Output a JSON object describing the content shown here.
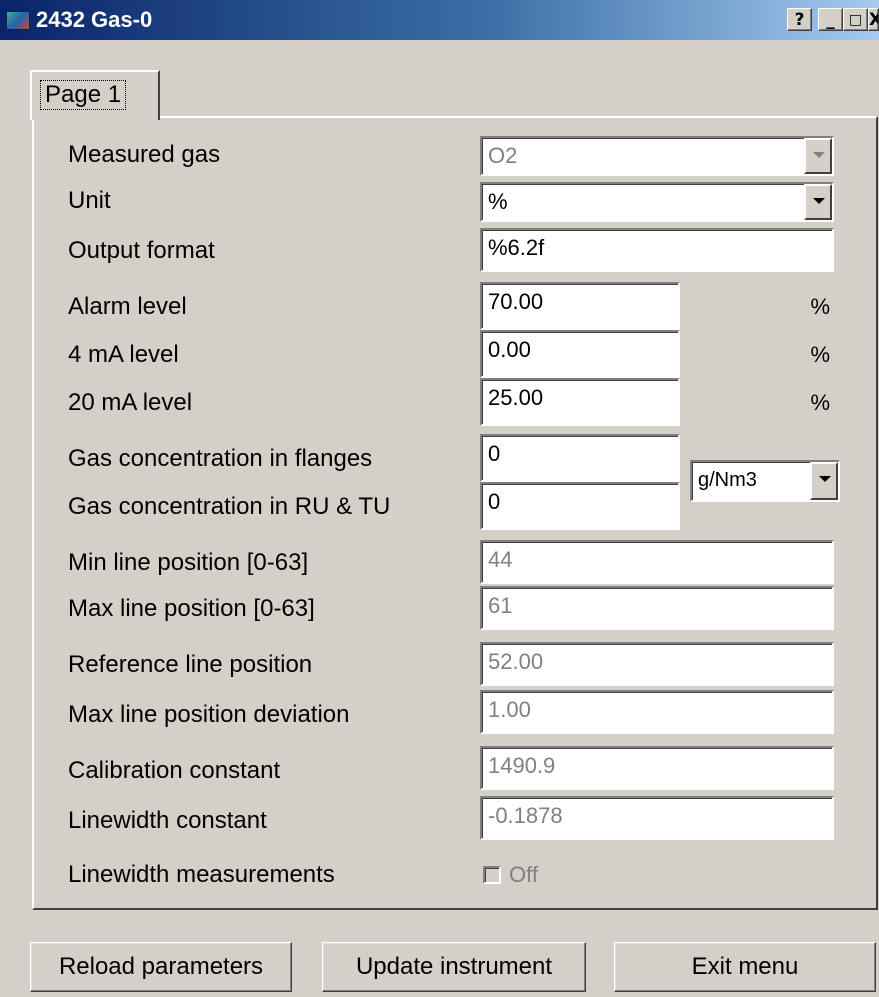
{
  "window": {
    "title": "2432 Gas-0",
    "help_label": "?",
    "minimize_label": "_",
    "maximize_label": "□",
    "close_label": "X"
  },
  "tabs": [
    {
      "label": "Page 1"
    }
  ],
  "fields": {
    "measured_gas": {
      "label": "Measured gas",
      "value": "O2"
    },
    "unit": {
      "label": "Unit",
      "value": "%"
    },
    "output_format": {
      "label": "Output format",
      "value": "%6.2f"
    },
    "alarm_level": {
      "label": "Alarm level",
      "value": "70.00",
      "unit": "%"
    },
    "ma4_level": {
      "label": "4 mA level",
      "value": "0.00",
      "unit": "%"
    },
    "ma20_level": {
      "label": "20 mA level",
      "value": "25.00",
      "unit": "%"
    },
    "gas_conc_flanges": {
      "label": "Gas concentration in flanges",
      "value": "0"
    },
    "gas_conc_ru_tu": {
      "label": "Gas concentration in RU & TU",
      "value": "0"
    },
    "conc_unit": {
      "value": "g/Nm3"
    },
    "min_line_pos": {
      "label": "Min line position [0-63]",
      "value": "44"
    },
    "max_line_pos": {
      "label": "Max line position [0-63]",
      "value": "61"
    },
    "ref_line_pos": {
      "label": "Reference line position",
      "value": "52.00"
    },
    "max_line_dev": {
      "label": "Max line position deviation",
      "value": "1.00"
    },
    "calibration_const": {
      "label": "Calibration constant",
      "value": "1490.9"
    },
    "linewidth_const": {
      "label": "Linewidth constant",
      "value": "-0.1878"
    },
    "linewidth_meas": {
      "label": "Linewidth measurements",
      "checkbox_label": "Off",
      "checked": false
    }
  },
  "buttons": {
    "reload": "Reload parameters",
    "update": "Update instrument",
    "exit": "Exit menu"
  }
}
